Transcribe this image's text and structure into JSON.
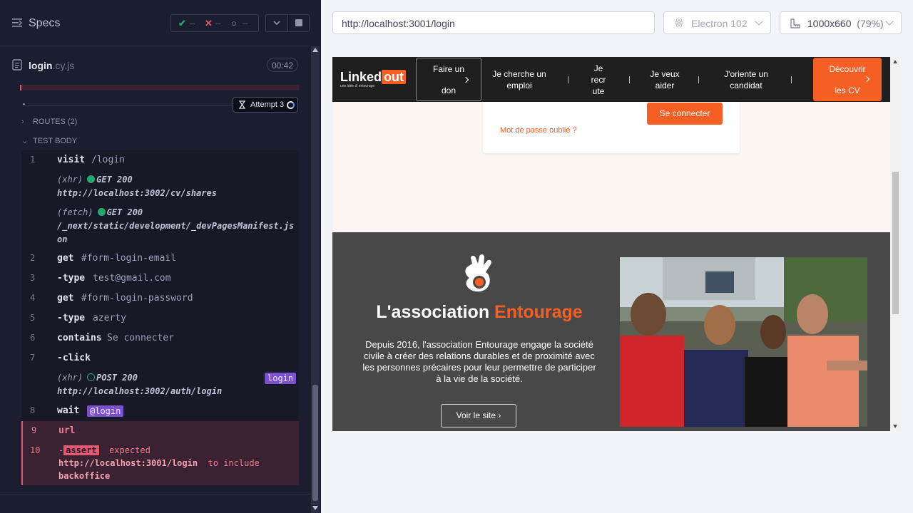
{
  "reporter": {
    "specs_label": "Specs",
    "stats": {
      "passed_icon": "✔",
      "passed": "–",
      "failed_icon": "✕",
      "failed": "–",
      "pending_icon": "○",
      "pending": "–"
    },
    "file": {
      "name": "login",
      "ext": ".cy.js",
      "duration": "00:42"
    },
    "attempt": "Attempt 3",
    "routes": "ROUTES (2)",
    "test_body": "TEST BODY",
    "commands": [
      {
        "num": "1",
        "name": "visit",
        "arg": "/login"
      },
      {
        "num": "2",
        "name": "get",
        "arg": "#form-login-email"
      },
      {
        "num": "3",
        "name": "-type",
        "arg": "test@gmail.com"
      },
      {
        "num": "4",
        "name": "get",
        "arg": "#form-login-password"
      },
      {
        "num": "5",
        "name": "-type",
        "arg": "azerty"
      },
      {
        "num": "6",
        "name": "contains",
        "arg": "Se connecter"
      },
      {
        "num": "7",
        "name": "-click",
        "arg": ""
      },
      {
        "num": "8",
        "name": "wait",
        "arg": "@login"
      },
      {
        "num": "9",
        "name": "url",
        "arg": ""
      },
      {
        "num": "10",
        "name": "-assert",
        "arg": ""
      }
    ],
    "requests": [
      {
        "kind": "(xhr)",
        "method": "GET 200",
        "url": "http://localhost:3002/cv/shares"
      },
      {
        "kind": "(fetch)",
        "method": "GET 200",
        "url": "/_next/static/development/_devPagesManifest.js",
        "url2": "on"
      },
      {
        "kind": "(xhr)",
        "method": "POST 200",
        "url": "http://localhost:3002/auth/login",
        "alias": "login"
      }
    ],
    "assert": {
      "tag": "assert",
      "expected": "expected",
      "value": "http://localhost:3001/login",
      "to_include": "to include",
      "target": "backoffice"
    }
  },
  "aut": {
    "url": "http://localhost:3001/login",
    "browser": "Electron 102",
    "viewport": "1000x660",
    "zoom": "(79%)"
  },
  "site": {
    "logo_main": "Linked",
    "logo_out": "out",
    "logo_sub": "une idée d' entourage",
    "nav": {
      "don_1": "Faire un",
      "don_2": "don",
      "emploi_1": "Je cherche un",
      "emploi_2": "emploi",
      "recrute_1": "Je",
      "recrute_2": "recr",
      "recrute_3": "ute",
      "aider_1": "Je veux",
      "aider_2": "aider",
      "oriente_1": "J'oriente un",
      "oriente_2": "candidat",
      "cv_1": "Découvrir",
      "cv_2": "les CV"
    },
    "login": {
      "button": "Se connecter",
      "forgot": "Mot de passe oublié ?"
    },
    "entourage": {
      "title_1": "L'association",
      "title_2": "Entourage",
      "description": "Depuis 2016, l'association Entourage engage la société civile à créer des relations durables et de proximité avec les personnes précaires pour leur permettre de participer à la vie de la société.",
      "button": "Voir le site"
    }
  },
  "colors": {
    "brand_orange": "#f55f24",
    "cypress_pass": "#1fa971",
    "cypress_fail": "#e45770",
    "alias_purple": "#7a4fd0"
  }
}
